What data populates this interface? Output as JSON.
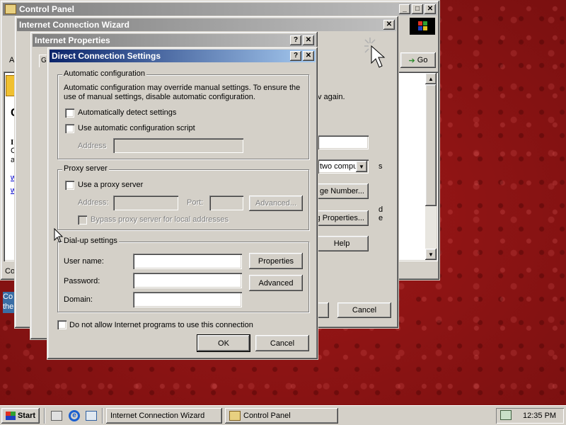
{
  "windows": {
    "control_panel": {
      "title": "Control Panel",
      "addressbar_letter": "A",
      "go_label": "Go",
      "status_text": "Con",
      "left_text_1": "Co",
      "left_text_2": "the",
      "letters": [
        "I",
        "C",
        "a",
        "w",
        "w",
        "C"
      ]
    },
    "wizard": {
      "title": "Internet Connection Wizard",
      "right_text": "v again.",
      "dropdown_value": "two compu",
      "dropdown_trailing": "s",
      "change_number_label": "ge Number...",
      "dialing_properties_label": "g Properties...",
      "help_label": "Help",
      "cancel_label": "Cancel",
      "trailing_letter_1": "d",
      "trailing_letter_2": "e"
    },
    "internet_properties": {
      "title": "Internet Properties",
      "tab_letter": "G"
    },
    "direct_connection": {
      "title": "Direct Connection Settings",
      "auto_config": {
        "group_label": "Automatic configuration",
        "description": "Automatic configuration may override manual settings.  To ensure the use of manual settings, disable automatic configuration.",
        "auto_detect_label": "Automatically detect settings",
        "use_script_label": "Use automatic configuration script",
        "address_label": "Address",
        "address_value": ""
      },
      "proxy": {
        "group_label": "Proxy server",
        "use_proxy_label": "Use a proxy server",
        "address_label": "Address:",
        "address_value": "",
        "port_label": "Port:",
        "port_value": "",
        "advanced_label": "Advanced...",
        "bypass_label": "Bypass proxy server for local addresses"
      },
      "dialup": {
        "group_label": "Dial-up settings",
        "username_label": "User name:",
        "username_value": "",
        "password_label": "Password:",
        "password_value": "",
        "domain_label": "Domain:",
        "domain_value": "",
        "properties_label": "Properties",
        "advanced_label": "Advanced"
      },
      "disallow_label": "Do not allow Internet programs to use this connection",
      "ok_label": "OK",
      "cancel_label": "Cancel"
    }
  },
  "taskbar": {
    "start_label": "Start",
    "tasks": [
      {
        "label": "Internet Connection Wizard"
      },
      {
        "label": "Control Panel"
      }
    ],
    "clock": "12:35 PM"
  },
  "colors": {
    "desktop": "#8e1414",
    "active_title": "#0a246a",
    "face": "#d4d0c8"
  }
}
